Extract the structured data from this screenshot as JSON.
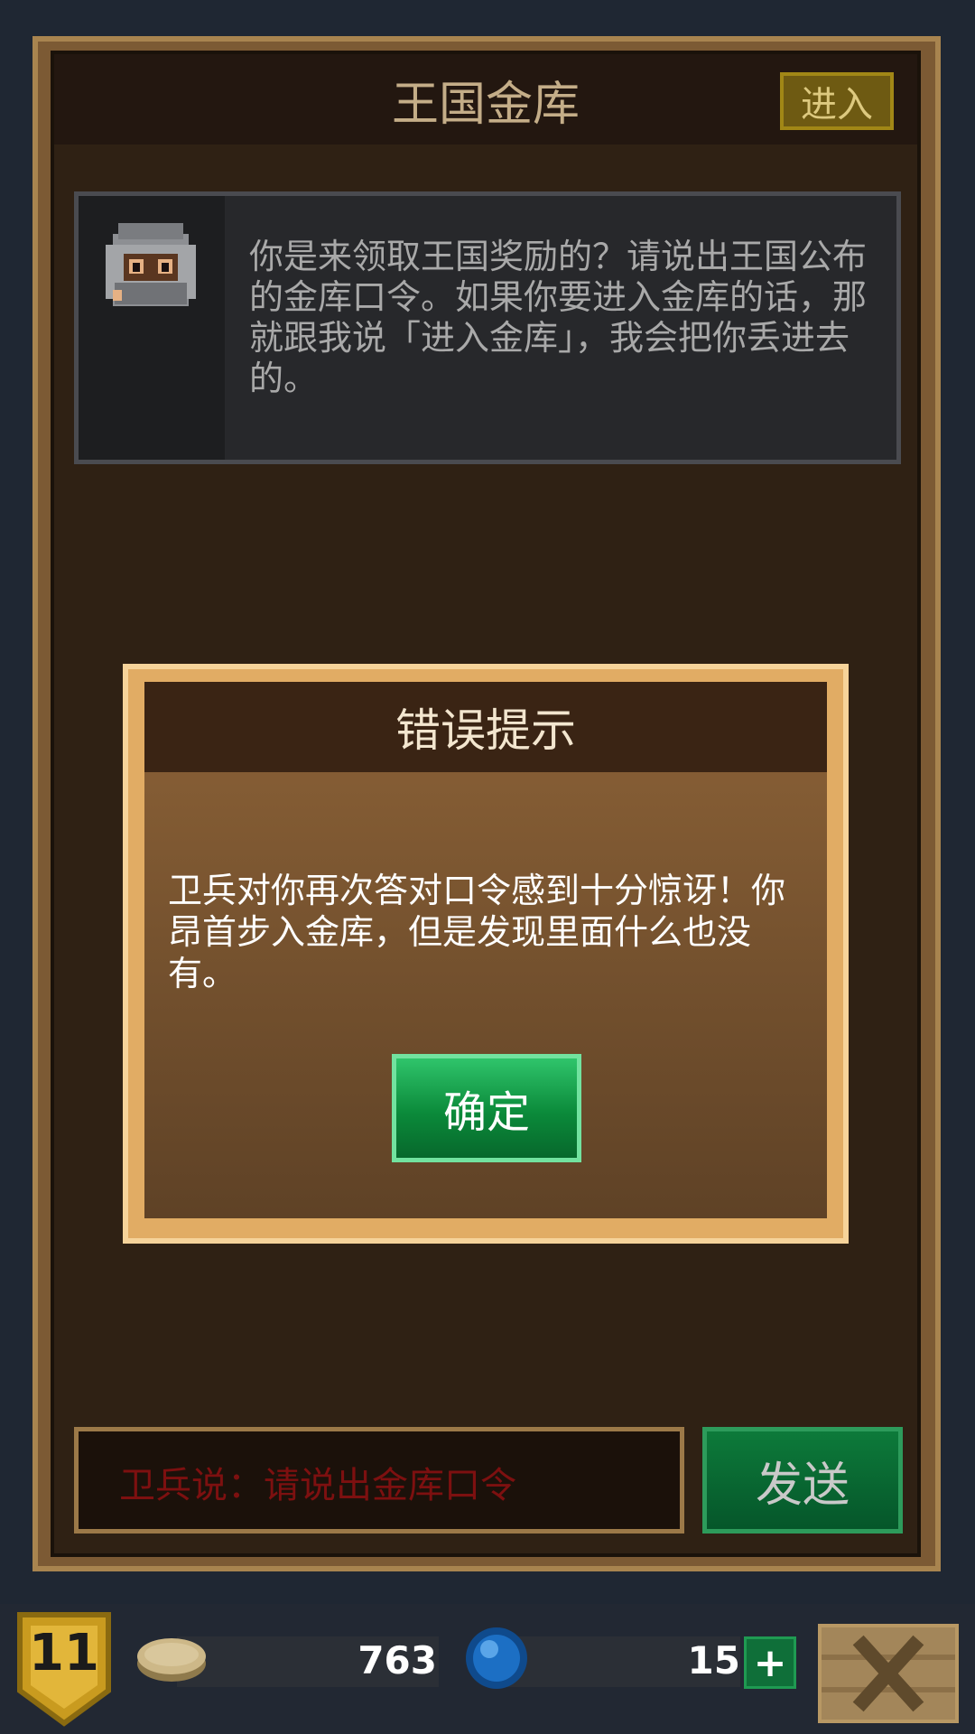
{
  "window": {
    "title": "王国金库",
    "enter_label": "进入"
  },
  "guard": {
    "dialog_text": "你是来领取王国奖励的？请说出王国公布的金库口令。如果你要进入金库的话，那就跟我说「进入金库」，我会把你丢进去的。"
  },
  "modal": {
    "title": "错误提示",
    "message": "卫兵对你再次答对口令感到十分惊讶！你昂首步入金库，但是发现里面什么也没有。",
    "ok_label": "确定"
  },
  "input": {
    "value": "卫兵说：请说出金库口令"
  },
  "send_label": "发送",
  "status": {
    "level": "11",
    "gold": "763",
    "gems": "15",
    "plus_label": "+"
  },
  "colors": {
    "frame": "#7c5a34",
    "panel": "#2f2114",
    "modal_border": "#e1ac64",
    "ok_green": "#0b8a3a",
    "input_text": "#7d1010"
  }
}
